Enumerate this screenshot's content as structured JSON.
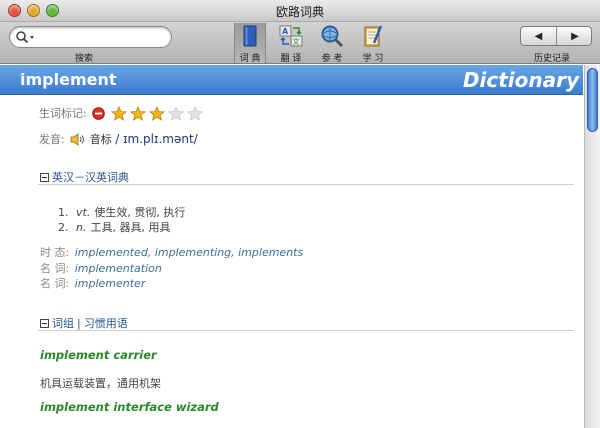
{
  "window": {
    "title": "欧路词典"
  },
  "toolbar": {
    "search": {
      "placeholder": "",
      "value": "",
      "label": "搜索"
    },
    "tools": [
      {
        "label": "词 典",
        "icon": "book-icon"
      },
      {
        "label": "翻 译",
        "icon": "translate-icon"
      },
      {
        "label": "参 考",
        "icon": "magnifier-globe-icon"
      },
      {
        "label": "学 习",
        "icon": "notebook-pencil-icon"
      }
    ],
    "nav": {
      "back": "◀",
      "forward": "▶",
      "label": "历史记录"
    }
  },
  "entry": {
    "headword": "implement",
    "dictionary_title": "Dictionary",
    "mark_label": "生词标记:",
    "stars_filled": 3,
    "stars_total": 5,
    "pronunciation_label": "发音:",
    "pronunciation_kind": "音标",
    "ipa": "/ ɪm.plɪ.mənt/"
  },
  "sections": {
    "en_zh": {
      "title": "英汉－汉英词典",
      "definitions": [
        {
          "num": "1.",
          "pos": "vt.",
          "text": "使生效, 贯彻, 执行"
        },
        {
          "num": "2.",
          "pos": "n.",
          "text": "工具, 器具, 用具"
        }
      ],
      "forms": [
        {
          "label": "时 态:",
          "value": "implemented, implementing, implements"
        },
        {
          "label": "名 词:",
          "value": "implementation"
        },
        {
          "label": "名 词:",
          "value": "implementer"
        }
      ]
    },
    "phrases": {
      "title_a": "词组",
      "separator": "|",
      "title_b": "习惯用语",
      "items": [
        {
          "phrase": "implement carrier",
          "meaning": "机具运载装置，通用机架"
        },
        {
          "phrase": "implement interface wizard",
          "meaning": ""
        }
      ]
    }
  },
  "colors": {
    "header_blue": "#3a7bce",
    "link_blue": "#24558f",
    "phrase_green": "#2a8a2a",
    "star_gold": "#f2b517"
  }
}
